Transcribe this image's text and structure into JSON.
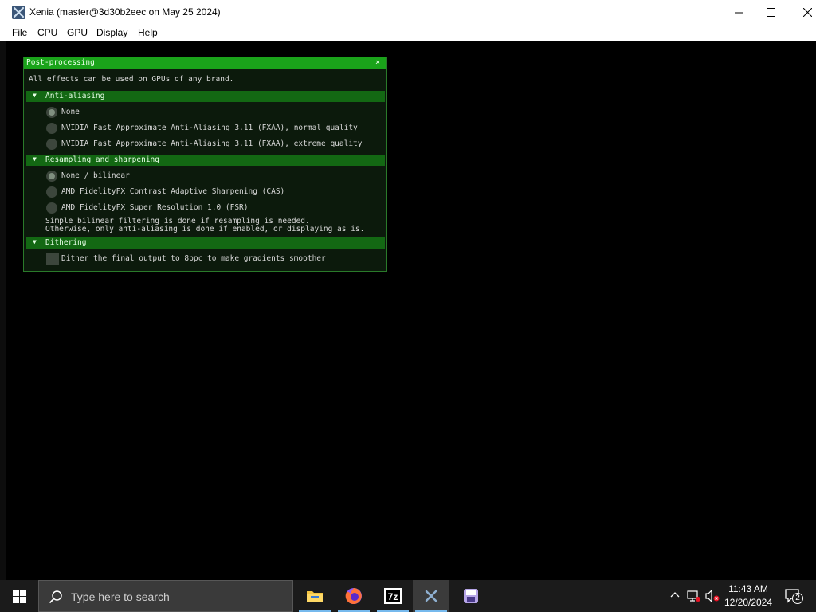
{
  "window": {
    "title": "Xenia (master@3d30b2eec on May 25 2024)"
  },
  "menu": {
    "items": [
      "File",
      "CPU",
      "GPU",
      "Display",
      "Help"
    ]
  },
  "post_processing": {
    "title": "Post-processing",
    "close_glyph": "×",
    "intro": "All effects can be used on GPUs of any brand.",
    "anti_aliasing": {
      "header": "Anti-aliasing",
      "options": [
        {
          "label": "None",
          "selected": true
        },
        {
          "label": "NVIDIA Fast Approximate Anti-Aliasing 3.11 (FXAA), normal quality",
          "selected": false
        },
        {
          "label": "NVIDIA Fast Approximate Anti-Aliasing 3.11 (FXAA), extreme quality",
          "selected": false
        }
      ]
    },
    "resampling": {
      "header": "Resampling and sharpening",
      "options": [
        {
          "label": "None / bilinear",
          "selected": true
        },
        {
          "label": "AMD FidelityFX Contrast Adaptive Sharpening (CAS)",
          "selected": false
        },
        {
          "label": "AMD FidelityFX Super Resolution 1.0 (FSR)",
          "selected": false
        }
      ],
      "note_line1": "Simple bilinear filtering is done if resampling is needed.",
      "note_line2": "Otherwise, only anti-aliasing is done if enabled, or displaying as is."
    },
    "dithering": {
      "header": "Dithering",
      "checkbox_label": "Dither the final output to 8bpc to make gradients smoother",
      "checked": false
    }
  },
  "taskbar": {
    "search_placeholder": "Type here to search",
    "apps": [
      "file-explorer",
      "firefox",
      "7-zip",
      "xenia",
      "save-manager"
    ],
    "time": "11:43 AM",
    "date": "12/20/2024",
    "notification_count": "2",
    "accent_color": "#76b9ed"
  },
  "colors": {
    "imgui_title_bg": "#1aa31a",
    "imgui_header_bg": "#136813",
    "imgui_window_bg": "#0c1a0c"
  }
}
